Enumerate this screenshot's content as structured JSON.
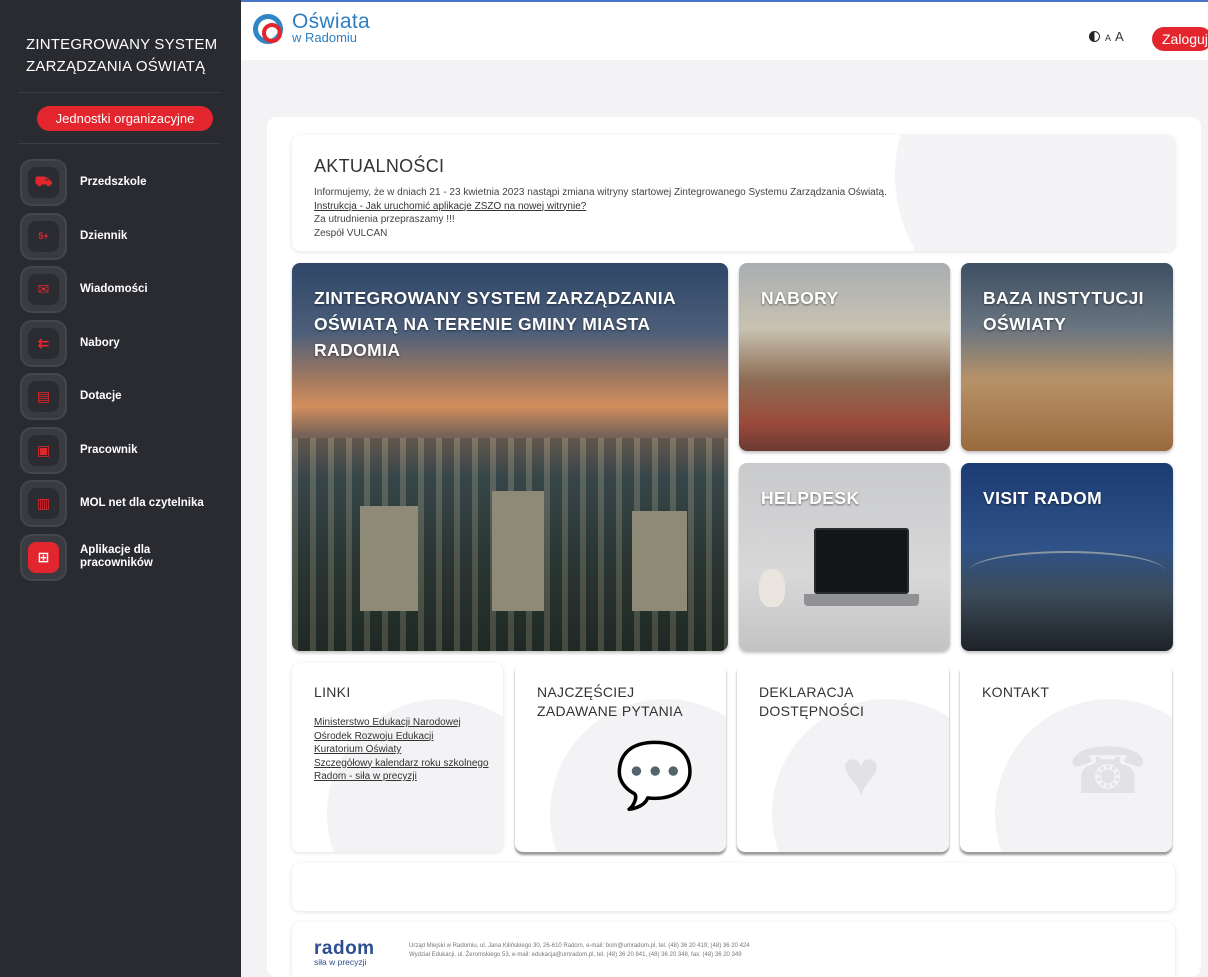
{
  "sidebar": {
    "title_line1": "ZINTEGROWANY SYSTEM",
    "title_line2": "ZARZĄDZANIA OŚWIATĄ",
    "org_button": "Jednostki organizacyjne",
    "items": [
      {
        "label": "Przedszkole",
        "icon": "preschool-icon"
      },
      {
        "label": "Dziennik",
        "icon": "journal-icon"
      },
      {
        "label": "Wiadomości",
        "icon": "megaphone-icon"
      },
      {
        "label": "Nabory",
        "icon": "enrollment-icon"
      },
      {
        "label": "Dotacje",
        "icon": "grants-icon"
      },
      {
        "label": "Pracownik",
        "icon": "briefcase-icon"
      },
      {
        "label": "MOL net dla czytelnika",
        "icon": "books-icon"
      },
      {
        "label": "Aplikacje dla pracowników",
        "icon": "grid-icon"
      }
    ]
  },
  "header": {
    "logo_line1": "Oświata",
    "logo_line2": "w Radomiu",
    "font_small": "A",
    "font_big": "A",
    "login": "Zaloguj"
  },
  "news": {
    "title": "AKTUALNOŚCI",
    "line1": "Informujemy, że w dniach 21 - 23 kwietnia 2023 nastąpi zmiana witryny startowej Zintegrowanego Systemu Zarządzania Oświatą.",
    "link": "Instrukcja - Jak uruchomić aplikacje ZSZO na nowej witrynie?",
    "line3": "Za utrudnienia przepraszamy !!!",
    "line4": "Zespół VULCAN"
  },
  "tiles": {
    "main": "ZINTEGROWANY SYSTEM ZARZĄDZANIA OŚWIATĄ NA TERENIE GMINY MIASTA RADOMIA",
    "nabory": "NABORY",
    "baza": "BAZA INSTYTUCJI OŚWIATY",
    "helpdesk": "HELPDESK",
    "visit": "VISIT RADOM"
  },
  "info": {
    "links_title": "LINKI",
    "links": [
      "Ministerstwo Edukacji Narodowej",
      "Ośrodek Rozwoju Edukacji",
      "Kuratorium Oświaty",
      "Szczegółowy kalendarz roku szkolnego",
      "Radom - siła w precyzji"
    ],
    "faq_title": "NAJCZĘŚCIEJ ZADAWANE PYTANIA",
    "accessibility_title": "DEKLARACJA DOSTĘPNOŚCI",
    "contact_title": "KONTAKT"
  },
  "footer": {
    "logo_line1": "radom",
    "logo_line2": "siła w precyzji",
    "line1": "Urząd Miejski w Radomiu, ul. Jana Kilińskiego 30, 26-610 Radom, e-mail: bom@umradom.pl, tel. (48) 36 20 419; (48) 36 20 424",
    "line2": "Wydział Edukacji, ul. Żeromskiego 53, e-mail: edukacja@umradom.pl, tel. (48) 36 20 841, (48) 36 20 348, fax. (48) 36 20 349"
  },
  "colors": {
    "accent": "#e3262e",
    "sidebar": "#2a2b30",
    "brand_blue": "#2f7fc1"
  }
}
